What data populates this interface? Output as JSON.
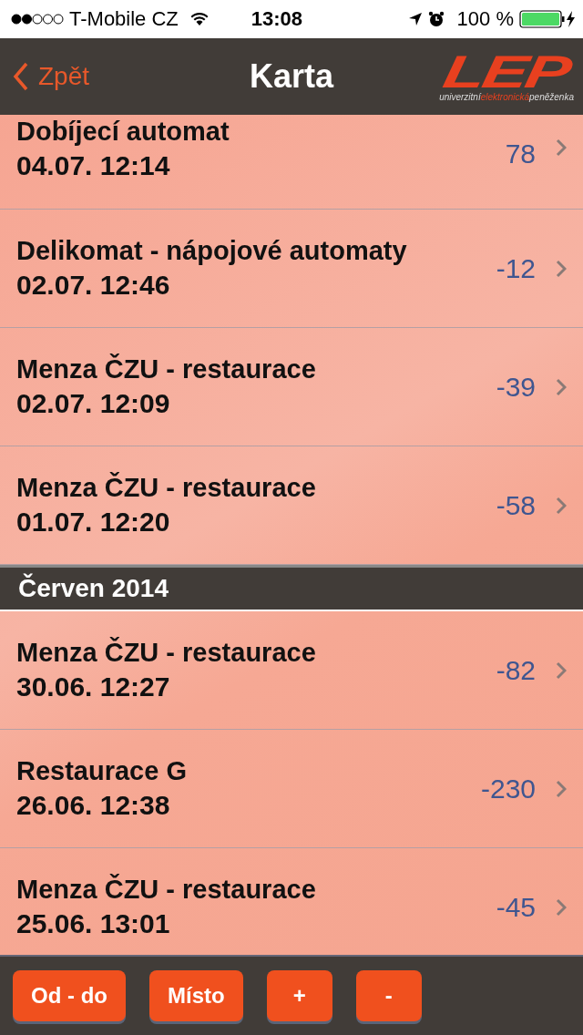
{
  "status_bar": {
    "carrier": "T-Mobile CZ",
    "time": "13:08",
    "battery": "100 %"
  },
  "nav_bar": {
    "back": "Zpět",
    "title": "Karta",
    "logo": {
      "mark": "LEP",
      "subtitle": [
        "univerzitní",
        "elektronická",
        "peněženka"
      ]
    }
  },
  "sections": [
    {
      "rows": [
        {
          "place": "Dobíjecí automat",
          "date": "04.07. 12:14",
          "amount": "78"
        },
        {
          "place": "Delikomat - nápojové automaty",
          "date": "02.07. 12:46",
          "amount": "-12"
        },
        {
          "place": "Menza ČZU - restaurace",
          "date": "02.07. 12:09",
          "amount": "-39"
        },
        {
          "place": "Menza ČZU - restaurace",
          "date": "01.07. 12:20",
          "amount": "-58"
        }
      ]
    },
    {
      "header": "Červen 2014",
      "rows": [
        {
          "place": "Menza ČZU - restaurace",
          "date": "30.06. 12:27",
          "amount": "-82"
        },
        {
          "place": "Restaurace G",
          "date": "26.06. 12:38",
          "amount": "-230"
        },
        {
          "place": "Menza ČZU - restaurace",
          "date": "25.06. 13:01",
          "amount": "-45"
        }
      ]
    }
  ],
  "toolbar": [
    "Od - do",
    "Místo",
    "+",
    "-"
  ]
}
